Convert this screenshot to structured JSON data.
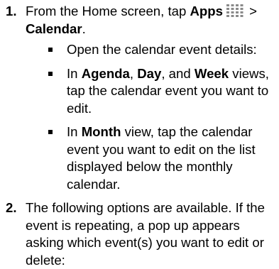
{
  "steps": [
    {
      "number": "1.",
      "text_before": "From the Home screen, tap ",
      "bold_1": "Apps",
      "icon": "apps-grid-icon",
      "text_middle": " > ",
      "bold_2": "Calendar",
      "text_end": ".",
      "bullets": [
        {
          "text": "Open the calendar event details:"
        },
        {
          "text_before": "In ",
          "bold_1": "Agenda",
          "sep_1": ", ",
          "bold_2": "Day",
          "sep_2": ", and ",
          "bold_3": "Week",
          "text_after": " views, tap the calendar event you want to edit."
        },
        {
          "text_before": "In ",
          "bold_1": "Month",
          "text_after": " view, tap the calendar event you want to edit on the list displayed below the monthly calendar."
        }
      ]
    },
    {
      "number": "2.",
      "text": "The following options are available. If the event is repeating, a pop up appears asking which event(s) you want to edit or delete:"
    }
  ]
}
